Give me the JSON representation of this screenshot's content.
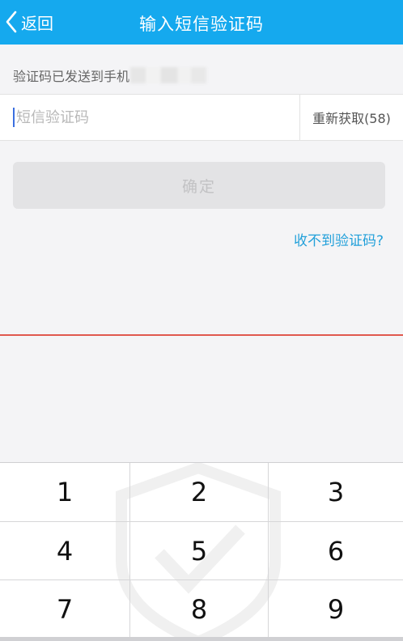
{
  "nav": {
    "back_label": "返回",
    "title": "输入短信验证码"
  },
  "info": {
    "sent_text": "验证码已发送到手机"
  },
  "code_field": {
    "placeholder": "短信验证码",
    "value": ""
  },
  "resend": {
    "label": "重新获取(58)"
  },
  "confirm": {
    "label": "确定"
  },
  "help": {
    "label": "收不到验证码?"
  },
  "keypad": {
    "keys": [
      "1",
      "2",
      "3",
      "4",
      "5",
      "6",
      "7",
      "8",
      "9"
    ]
  },
  "colors": {
    "nav_bg": "#15a9ee",
    "link": "#22a0da",
    "divider": "#e0584e"
  }
}
